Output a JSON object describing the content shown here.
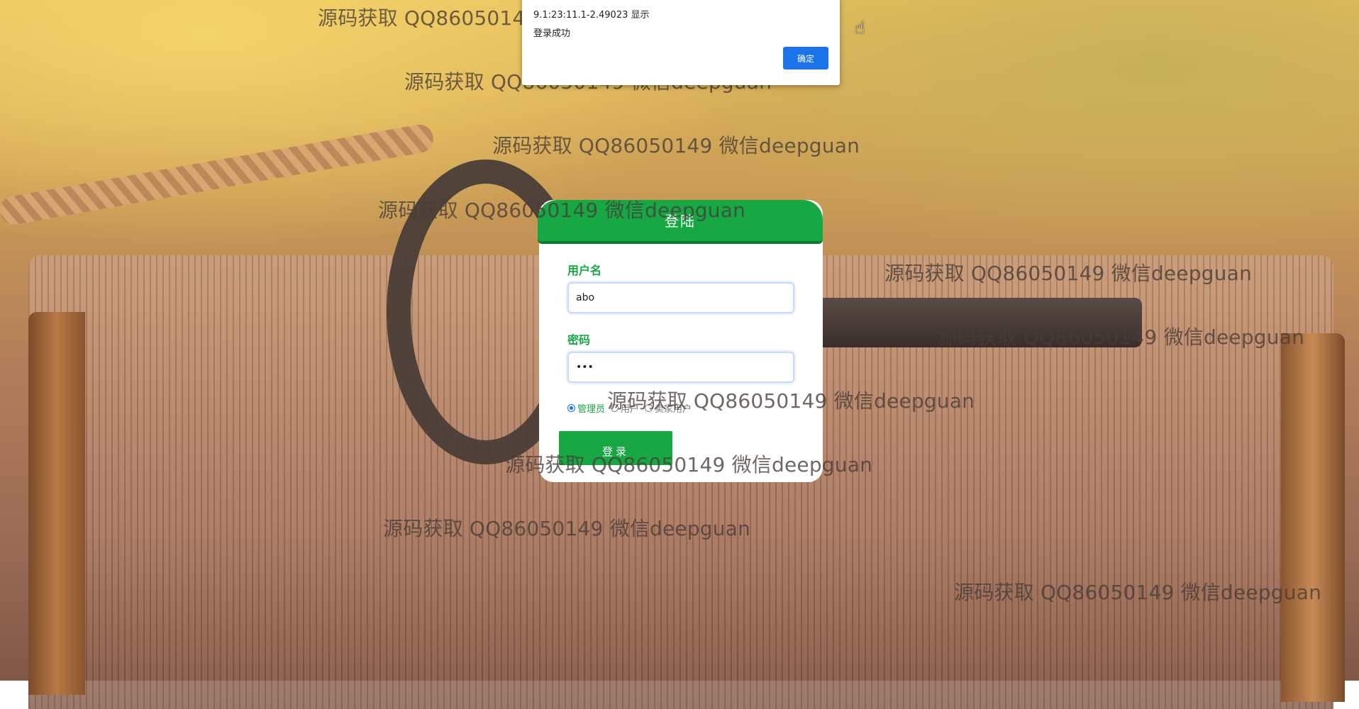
{
  "alert": {
    "host": "9.1:23:11.1-2.49023 显示",
    "message": "登录成功",
    "ok_label": "确定"
  },
  "login": {
    "title": "登陆",
    "username_label": "用户名",
    "username_value": "abo",
    "password_label": "密码",
    "password_value": "abc",
    "roles": [
      {
        "label": "管理员",
        "checked": true
      },
      {
        "label": "用户",
        "checked": false
      },
      {
        "label": "卖家用户",
        "checked": false
      }
    ],
    "submit_label": "登录"
  },
  "watermark": {
    "text": "源码获取 QQ86050149 微信deepguan"
  },
  "colors": {
    "accent_green": "#17a844",
    "dialog_button_blue": "#1a73e8"
  }
}
